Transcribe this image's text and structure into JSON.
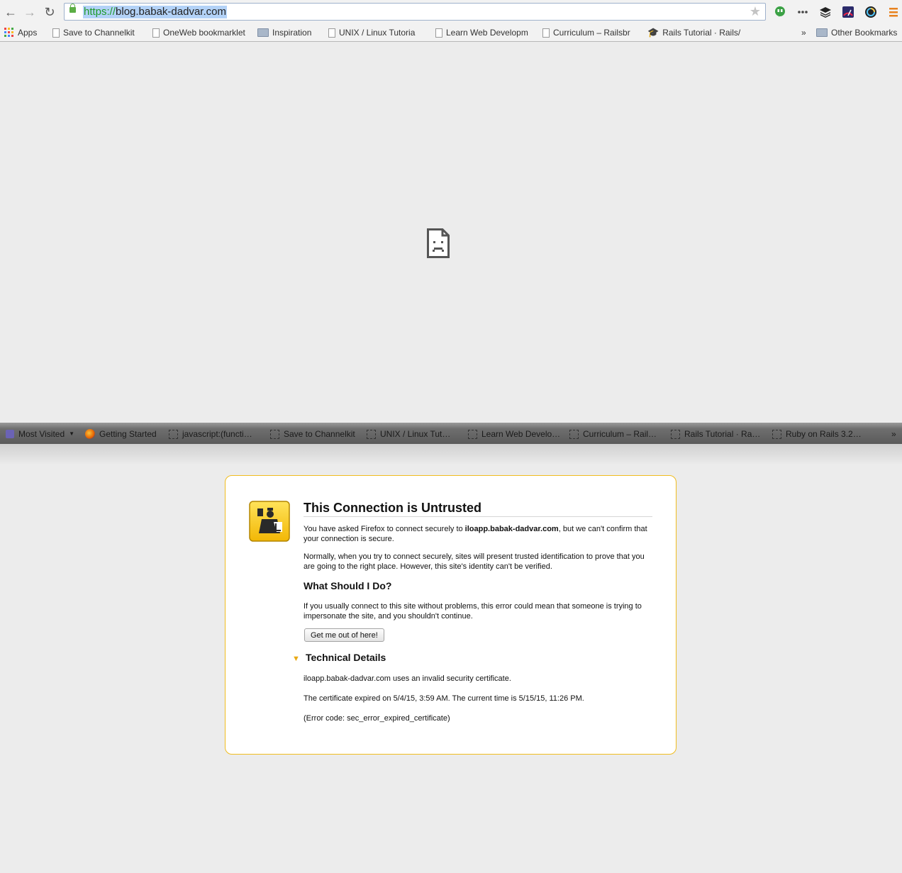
{
  "browser": {
    "url_scheme": "https://",
    "url_host": "blog.babak-dadvar.com",
    "bookmarks": [
      {
        "label": "Apps",
        "icon": "apps-grid-icon"
      },
      {
        "label": "Save to Channelkit",
        "icon": "page-icon"
      },
      {
        "label": "OneWeb bookmarklet",
        "icon": "page-icon"
      },
      {
        "label": "Inspiration",
        "icon": "folder-icon"
      },
      {
        "label": "UNIX / Linux Tutoria",
        "icon": "page-icon"
      },
      {
        "label": "Learn Web Developm",
        "icon": "page-icon"
      },
      {
        "label": "Curriculum – Railsbr",
        "icon": "page-icon"
      },
      {
        "label": "Rails Tutorial · Rails/",
        "icon": "grad-cap-icon"
      }
    ],
    "overflow_chevron": "»",
    "other_bookmarks": "Other Bookmarks"
  },
  "firefox": {
    "bookmarks": [
      {
        "label": "Most Visited"
      },
      {
        "label": "Getting Started"
      },
      {
        "label": "javascript:(functi…"
      },
      {
        "label": "Save to Channelkit"
      },
      {
        "label": "UNIX / Linux Tut…"
      },
      {
        "label": "Learn Web Develo…"
      },
      {
        "label": "Curriculum – Rail…"
      },
      {
        "label": "Rails Tutorial · Ra…"
      },
      {
        "label": "Ruby on Rails 3.2…"
      }
    ],
    "overflow_chevron": "»"
  },
  "error": {
    "title": "This Connection is Untrusted",
    "p1_pre": "You have asked Firefox to connect securely to ",
    "p1_host": "iloapp.babak-dadvar.com",
    "p1_post": ", but we can't confirm that your connection is secure.",
    "p2": "Normally, when you try to connect securely, sites will present trusted identification to prove that you are going to the right place. However, this site's identity can't be verified.",
    "subhead": "What Should I Do?",
    "p3": "If you usually connect to this site without problems, this error could mean that someone is trying to impersonate the site, and you shouldn't continue.",
    "button": "Get me out of here!",
    "tech_heading": "Technical Details",
    "tech1": "iloapp.babak-dadvar.com uses an invalid security certificate.",
    "tech2": "The certificate expired on 5/4/15, 3:59 AM. The current time is 5/15/15, 11:26 PM.",
    "tech3": "(Error code: sec_error_expired_certificate)"
  },
  "colors": {
    "card_border": "#f0bd1f",
    "url_selection": "#b3d2f7",
    "https_green": "#1e9a2a"
  }
}
